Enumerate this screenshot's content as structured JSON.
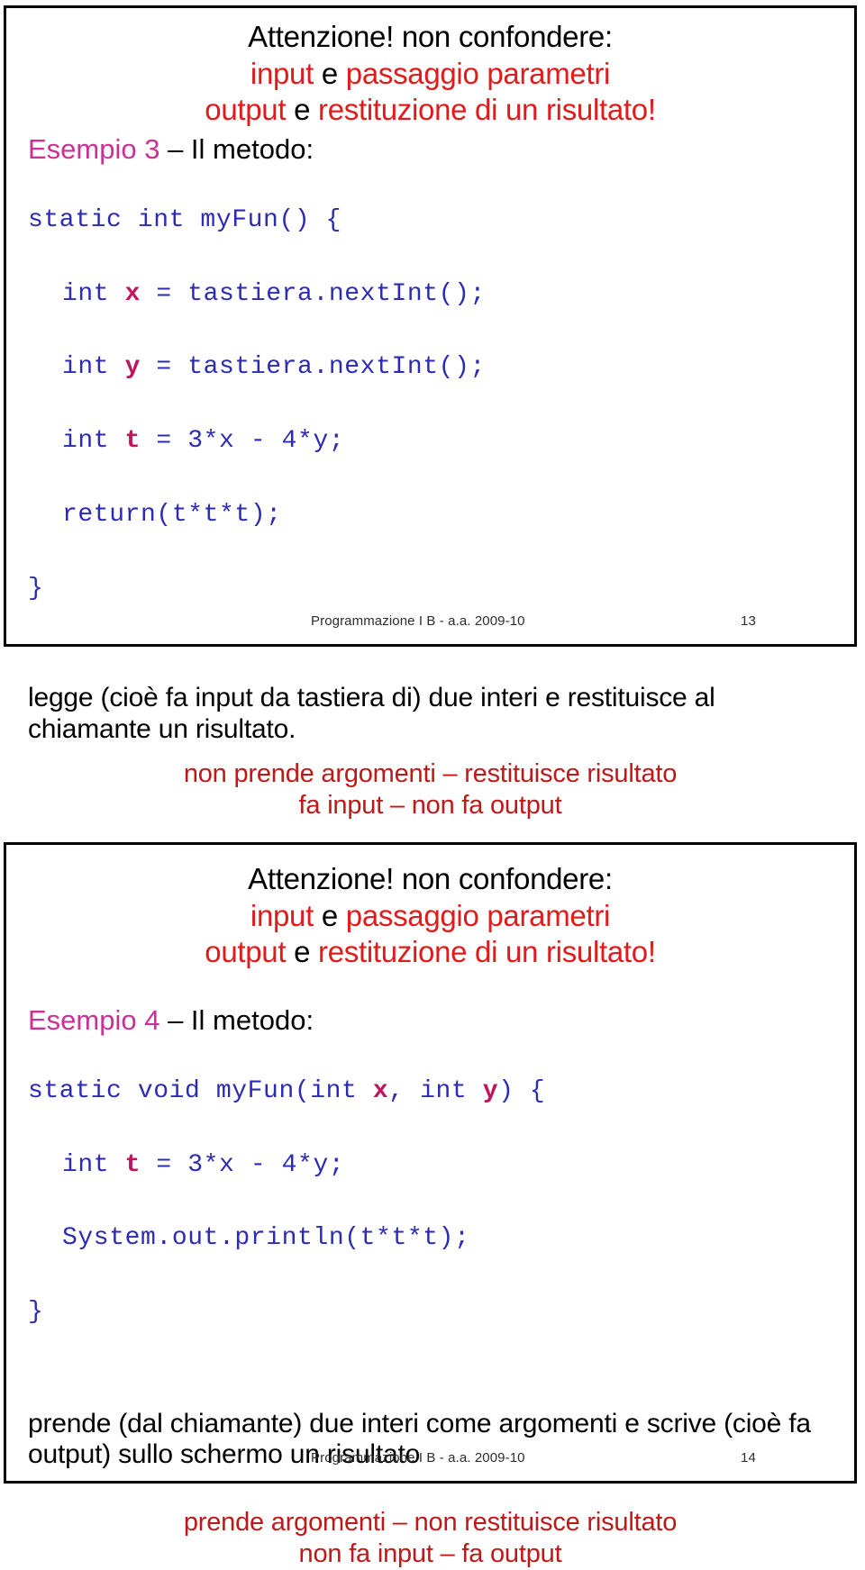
{
  "document": {
    "kind": "lecture-slides",
    "colors": {
      "red": "#e11b1b",
      "dark_red": "#c01818",
      "magenta": "#cc2f95",
      "code_blue": "#2b2bb5",
      "code_variable": "#c0145f",
      "text": "#000000",
      "border": "#000000",
      "background": "#ffffff"
    }
  },
  "slides": [
    {
      "id": "slide-13",
      "title": {
        "line1": "Attenzione! non confondere:",
        "line2_a": "input",
        "line2_b": " e ",
        "line2_c": "passaggio parametri",
        "line3_a": "output",
        "line3_b": " e ",
        "line3_c": "restituzione di un risultato",
        "line3_d": "!"
      },
      "esempio": {
        "label": "Esempio 3",
        "rest": " – Il metodo:"
      },
      "code": {
        "line1_a": "static int myFun() {",
        "line2_a": "int ",
        "line2_var": "x",
        "line2_b": " = tastiera.nextInt();",
        "line3_a": "int ",
        "line3_var": "y",
        "line3_b": " = tastiera.nextInt();",
        "line4_a": "int ",
        "line4_var": "t",
        "line4_b": " = 3*x - 4*y;",
        "line5_a": "return(t*t*t);",
        "line6_a": "}"
      },
      "prose": "legge (cioè fa input da tastiera di) due interi e restituisce al chiamante un risultato.",
      "summary": {
        "line1": "non prende argomenti – restituisce risultato",
        "line2": "fa input – non fa output"
      },
      "footer": {
        "text": "Programmazione I B - a.a. 2009-10",
        "page": "13"
      }
    },
    {
      "id": "slide-14",
      "title": {
        "line1": "Attenzione! non confondere:",
        "line2_a": "input",
        "line2_b": " e ",
        "line2_c": "passaggio parametri",
        "line3_a": "output",
        "line3_b": " e ",
        "line3_c": "restituzione di un risultato",
        "line3_d": "!"
      },
      "esempio": {
        "label": "Esempio 4",
        "rest": " – Il metodo:"
      },
      "code": {
        "line1_a": "static void myFun(int ",
        "line1_var1": "x",
        "line1_b": ", int ",
        "line1_var2": "y",
        "line1_c": ") {",
        "line2_a": "int ",
        "line2_var": "t",
        "line2_b": " = 3*x - 4*y;",
        "line3_a": "System.out.println(t*t*t);",
        "line4_a": "}"
      },
      "prose": "prende (dal chiamante) due interi come argomenti e scrive (cioè fa output) sullo schermo un risultato",
      "summary": {
        "line1": "prende argomenti – non restituisce risultato",
        "line2": "non fa input – fa output"
      },
      "footer": {
        "text": "Programmazione I B - a.a. 2009-10",
        "page": "14"
      }
    }
  ]
}
